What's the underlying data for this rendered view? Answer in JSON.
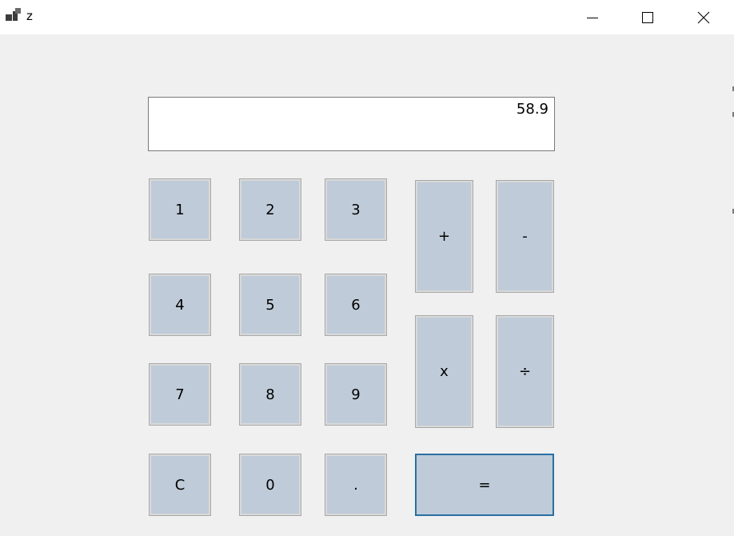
{
  "window": {
    "title": "z",
    "controls": {
      "minimize_icon": "minimize-icon",
      "maximize_icon": "maximize-icon",
      "close_icon": "close-icon"
    }
  },
  "display": {
    "value": "58.9"
  },
  "keys": {
    "k1": "1",
    "k2": "2",
    "k3": "3",
    "k4": "4",
    "k5": "5",
    "k6": "6",
    "k7": "7",
    "k8": "8",
    "k9": "9",
    "clear": "C",
    "k0": "0",
    "dot": ".",
    "plus": "+",
    "minus": "-",
    "multiply": "x",
    "divide": "÷",
    "equals": "="
  },
  "colors": {
    "key_background": "#bfcbd8",
    "default_button_border": "#2a6fa3",
    "window_background": "#f0f0f0"
  }
}
